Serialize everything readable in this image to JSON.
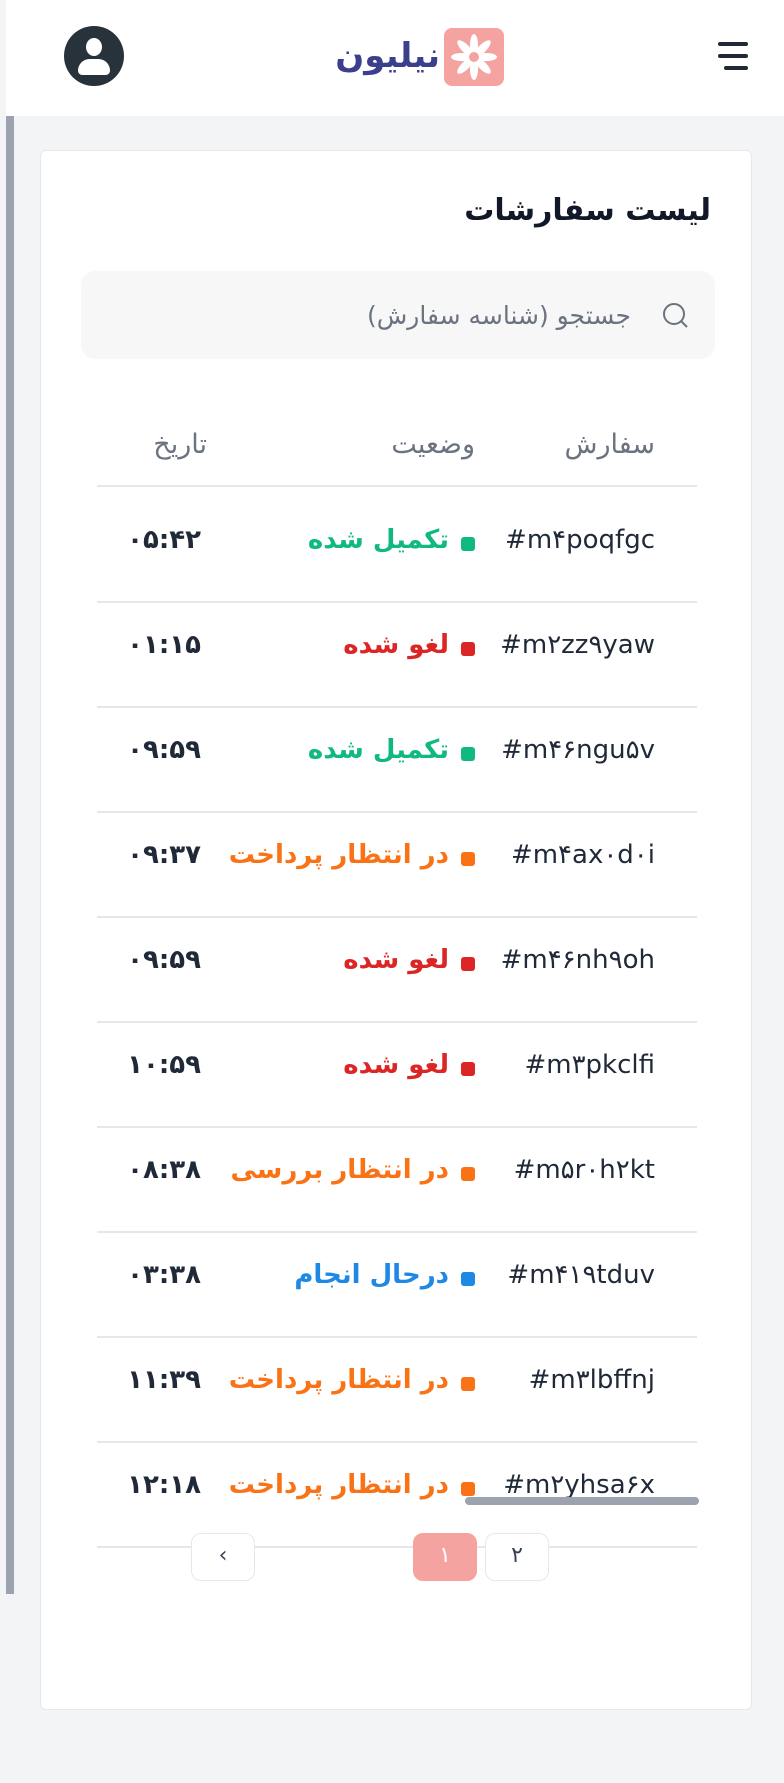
{
  "header": {
    "logo_text": "نیلیون",
    "menu_icon": "hamburger-menu-icon",
    "profile_icon": "user-avatar-icon"
  },
  "orders": {
    "title": "لیست سفارشات",
    "search_placeholder": "جستجو (شناسه سفارش)",
    "columns": {
      "order": "سفارش",
      "status": "وضعیت",
      "date": "تاریخ"
    },
    "rows": [
      {
        "order": "#m۴poqfgc",
        "status": "تکمیل شده",
        "status_color": "#10b981",
        "date": "۰۵:۴۲"
      },
      {
        "order": "#m۲zz۹yaw",
        "status": "لغو شده",
        "status_color": "#dc2626",
        "date": "۰۱:۱۵"
      },
      {
        "order": "#m۴۶ngu۵v",
        "status": "تکمیل شده",
        "status_color": "#10b981",
        "date": "۰۹:۵۹"
      },
      {
        "order": "#m۴ax۰d۰i",
        "status": "در انتظار پرداخت",
        "status_color": "#f97316",
        "date": "۰۹:۳۷"
      },
      {
        "order": "#m۴۶nh۹oh",
        "status": "لغو شده",
        "status_color": "#dc2626",
        "date": "۰۹:۵۹"
      },
      {
        "order": "#m۳pkclfi",
        "status": "لغو شده",
        "status_color": "#dc2626",
        "date": "۱۰:۵۹"
      },
      {
        "order": "#m۵r۰h۲kt",
        "status": "در انتظار بررسی",
        "status_color": "#f97316",
        "date": "۰۸:۳۸"
      },
      {
        "order": "#m۴۱۹tduv",
        "status": "درحال انجام",
        "status_color": "#1e88e5",
        "date": "۰۳:۳۸"
      },
      {
        "order": "#m۳lbffnj",
        "status": "در انتظار پرداخت",
        "status_color": "#f97316",
        "date": "۱۱:۳۹"
      },
      {
        "order": "#m۲yhsa۶x",
        "status": "در انتظار پرداخت",
        "status_color": "#f97316",
        "date": "۱۲:۱۸"
      }
    ]
  },
  "pagination": {
    "current": "۱",
    "next": "۲"
  }
}
